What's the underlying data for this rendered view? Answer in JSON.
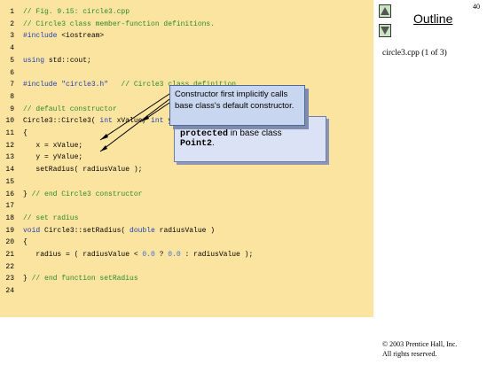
{
  "page_number": "40",
  "nav": {
    "outline_label": "Outline",
    "file_label": "circle3.cpp (1 of 3)"
  },
  "code_lines": [
    {
      "n": "1",
      "tokens": [
        {
          "t": "// Fig. 9.15: circle3.cpp",
          "c": "cm"
        }
      ]
    },
    {
      "n": "2",
      "tokens": [
        {
          "t": "// Circle3 class member-function definitions.",
          "c": "cm"
        }
      ]
    },
    {
      "n": "3",
      "tokens": [
        {
          "t": "#include ",
          "c": "kw"
        },
        {
          "t": "<iostream>",
          "c": ""
        }
      ]
    },
    {
      "n": "4",
      "tokens": []
    },
    {
      "n": "5",
      "tokens": [
        {
          "t": "using ",
          "c": "kw"
        },
        {
          "t": "std::cout;",
          "c": ""
        }
      ]
    },
    {
      "n": "6",
      "tokens": []
    },
    {
      "n": "7",
      "tokens": [
        {
          "t": "#include ",
          "c": "kw"
        },
        {
          "t": "\"circle3.h\"",
          "c": "st"
        },
        {
          "t": "   // Circle3 class definition",
          "c": "cm"
        }
      ]
    },
    {
      "n": "8",
      "tokens": []
    },
    {
      "n": "9",
      "tokens": [
        {
          "t": "// default constructor",
          "c": "cm"
        }
      ]
    },
    {
      "n": "10",
      "tokens": [
        {
          "t": "Circle3::Circle3( ",
          "c": ""
        },
        {
          "t": "int ",
          "c": "kw"
        },
        {
          "t": "xValue, ",
          "c": ""
        },
        {
          "t": "int ",
          "c": "kw"
        },
        {
          "t": "yValue, ",
          "c": ""
        },
        {
          "t": "double ",
          "c": "kw"
        },
        {
          "t": "radiusValue )",
          "c": ""
        }
      ]
    },
    {
      "n": "11",
      "tokens": [
        {
          "t": "{",
          "c": ""
        }
      ]
    },
    {
      "n": "12",
      "tokens": [
        {
          "t": "   x = xValue;",
          "c": ""
        }
      ]
    },
    {
      "n": "13",
      "tokens": [
        {
          "t": "   y = yValue;",
          "c": ""
        }
      ]
    },
    {
      "n": "14",
      "tokens": [
        {
          "t": "   setRadius( radiusValue );",
          "c": ""
        }
      ]
    },
    {
      "n": "15",
      "tokens": []
    },
    {
      "n": "16",
      "tokens": [
        {
          "t": "} ",
          "c": ""
        },
        {
          "t": "// end Circle3 constructor",
          "c": "cm"
        }
      ]
    },
    {
      "n": "17",
      "tokens": []
    },
    {
      "n": "18",
      "tokens": [
        {
          "t": "// set radius",
          "c": "cm"
        }
      ]
    },
    {
      "n": "19",
      "tokens": [
        {
          "t": "void ",
          "c": "kw"
        },
        {
          "t": "Circle3::setRadius( ",
          "c": ""
        },
        {
          "t": "double ",
          "c": "kw"
        },
        {
          "t": "radiusValue )",
          "c": ""
        }
      ]
    },
    {
      "n": "20",
      "tokens": [
        {
          "t": "{",
          "c": ""
        }
      ]
    },
    {
      "n": "21",
      "tokens": [
        {
          "t": "   radius = ( radiusValue < ",
          "c": ""
        },
        {
          "t": "0.0",
          "c": "num"
        },
        {
          "t": " ? ",
          "c": ""
        },
        {
          "t": "0.0",
          "c": "num"
        },
        {
          "t": " : radiusValue );",
          "c": ""
        }
      ]
    },
    {
      "n": "22",
      "tokens": []
    },
    {
      "n": "23",
      "tokens": [
        {
          "t": "} ",
          "c": ""
        },
        {
          "t": "// end function setRadius",
          "c": "cm"
        }
      ]
    },
    {
      "n": "24",
      "tokens": []
    }
  ],
  "callouts": {
    "front_text": "Constructor first implicitly calls base class's default constructor.",
    "back_code_word": "protected",
    "back_text_1": " in base class",
    "back_code_word_2": "Point2",
    "back_text_2": "."
  },
  "copyright": {
    "line1": "© 2003 Prentice Hall, Inc.",
    "line2": "All rights reserved."
  },
  "colors": {
    "code_bg": "#fbe4a0",
    "comment": "#2d8a2d",
    "keyword": "#1f3fb0",
    "callout_bg": "#c9d6ef"
  },
  "icons": {
    "up": "triangle-up-icon",
    "down": "triangle-down-icon"
  }
}
